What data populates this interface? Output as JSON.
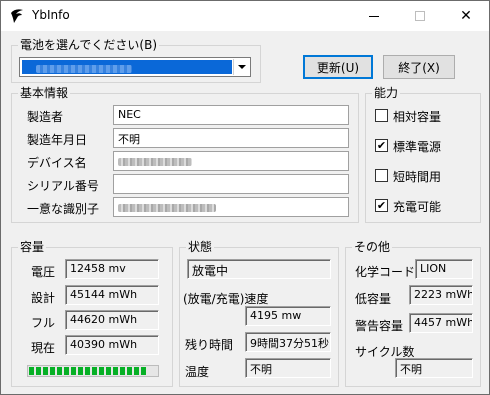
{
  "window": {
    "title": "YbInfo"
  },
  "titlebar": {
    "minimize_icon": "minimize-icon",
    "maximize_icon": "maximize-icon",
    "close_icon": "close-icon",
    "close_glyph": "✕"
  },
  "battery_select": {
    "group_label": "電池を選んでください(B)"
  },
  "buttons": {
    "update": "更新(U)",
    "exit": "終了(X)"
  },
  "basic_info": {
    "group_label": "基本情報",
    "manufacturer_label": "製造者",
    "manufacturer_value": "NEC",
    "manufacture_date_label": "製造年月日",
    "manufacture_date_value": "不明",
    "device_name_label": "デバイス名",
    "serial_label": "シリアル番号",
    "unique_id_label": "一意な識別子"
  },
  "capability": {
    "group_label": "能力",
    "items": [
      {
        "label": "相対容量",
        "checked": false
      },
      {
        "label": "標準電源",
        "checked": true
      },
      {
        "label": "短時間用",
        "checked": false
      },
      {
        "label": "充電可能",
        "checked": true
      }
    ]
  },
  "capacity": {
    "group_label": "容量",
    "voltage_label": "電圧",
    "voltage_value": "12458 mv",
    "design_label": "設計",
    "design_value": "45144 mWh",
    "full_label": "フル",
    "full_value": "44620 mWh",
    "current_label": "現在",
    "current_value": "40390 mWh",
    "charge_level": 0.905
  },
  "state": {
    "group_label": "状態",
    "status_value": "放電中",
    "rate_label": "(放電/充電)速度",
    "rate_value": "4195 mw",
    "remaining_label": "残り時間",
    "remaining_value": "9時間37分51秒",
    "temperature_label": "温度",
    "temperature_value": "不明"
  },
  "other": {
    "group_label": "その他",
    "chemistry_label": "化学コード",
    "chemistry_value": "LION",
    "low_capacity_label": "低容量",
    "low_capacity_value": "2223 mWh",
    "warning_capacity_label": "警告容量",
    "warning_capacity_value": "4457 mWh",
    "cycle_count_label": "サイクル数",
    "cycle_count_value": "不明"
  },
  "colors": {
    "selection": "#0a68d8",
    "progress": "#06b025",
    "focus_border": "#0078d7"
  }
}
